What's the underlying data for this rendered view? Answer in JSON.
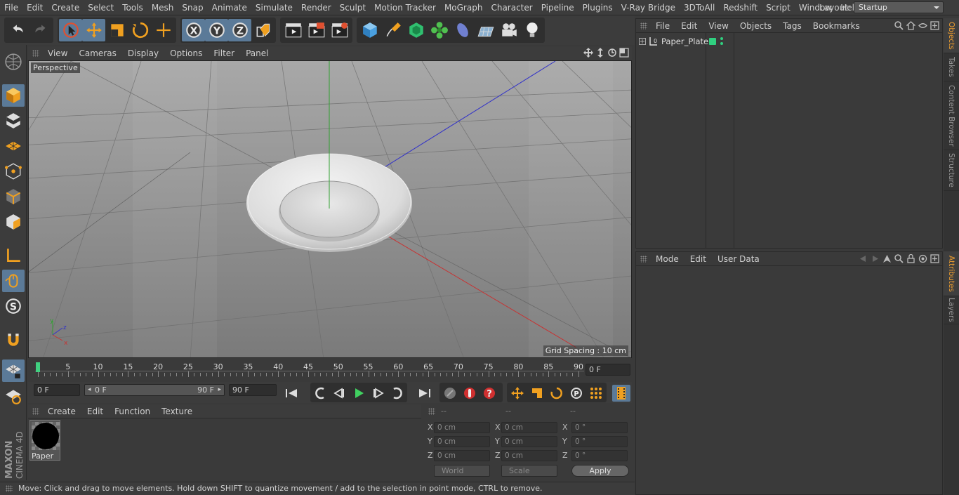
{
  "menubar": {
    "items": [
      "File",
      "Edit",
      "Create",
      "Select",
      "Tools",
      "Mesh",
      "Snap",
      "Animate",
      "Simulate",
      "Render",
      "Sculpt",
      "Motion Tracker",
      "MoGraph",
      "Character",
      "Pipeline",
      "Plugins",
      "V-Ray Bridge",
      "3DToAll",
      "Redshift",
      "Script",
      "Window",
      "Help"
    ],
    "layout_label": "Layout:",
    "layout_value": "Startup"
  },
  "toolbar": {
    "icons": [
      "undo-icon",
      "redo-icon",
      "live-selection-icon",
      "move-icon",
      "scale-icon",
      "rotate-icon",
      "last-tool-icon",
      "x-axis-icon",
      "y-axis-icon",
      "z-axis-icon",
      "coordinate-system-icon",
      "render-view-icon",
      "render-picture-viewer-icon",
      "edit-render-settings-icon",
      "cube-icon",
      "pen-icon",
      "subdivision-icon",
      "mograph-cloner-icon",
      "deformer-icon",
      "floor-icon",
      "camera-icon",
      "light-icon"
    ]
  },
  "viewport": {
    "menu": [
      "View",
      "Cameras",
      "Display",
      "Options",
      "Filter",
      "Panel"
    ],
    "label": "Perspective",
    "grid_spacing": "Grid Spacing : 10 cm"
  },
  "timeline": {
    "ticks": [
      "0",
      "5",
      "10",
      "15",
      "20",
      "25",
      "30",
      "35",
      "40",
      "45",
      "50",
      "55",
      "60",
      "65",
      "70",
      "75",
      "80",
      "85",
      "90"
    ],
    "current_frame": "0 F"
  },
  "playbar": {
    "start_field": "0 F",
    "range_start": "0 F",
    "range_end": "90 F",
    "end_field": "90 F"
  },
  "material_manager": {
    "menu": [
      "Create",
      "Edit",
      "Function",
      "Texture"
    ],
    "materials": [
      {
        "name": "Paper"
      }
    ]
  },
  "coordinates": {
    "headers": [
      "--",
      "--",
      "--"
    ],
    "rows": [
      {
        "axis": "X",
        "pos": "0 cm",
        "size": "0 cm",
        "rot": "0 °"
      },
      {
        "axis": "Y",
        "pos": "0 cm",
        "size": "0 cm",
        "rot": "0 °"
      },
      {
        "axis": "Z",
        "pos": "0 cm",
        "size": "0 cm",
        "rot": "0 °"
      }
    ],
    "mode_select": "World",
    "scale_select": "Scale",
    "apply_label": "Apply"
  },
  "object_manager": {
    "menu": [
      "File",
      "Edit",
      "View",
      "Objects",
      "Tags",
      "Bookmarks"
    ],
    "objects": [
      {
        "name": "Paper_Plate"
      }
    ]
  },
  "attribute_manager": {
    "menu": [
      "Mode",
      "Edit",
      "User Data"
    ]
  },
  "right_tabs": [
    "Objects",
    "Takes",
    "Content Browser",
    "Structure",
    "Attributes",
    "Layers"
  ],
  "status": "Move: Click and drag to move elements. Hold down SHIFT to quantize movement / add to the selection in point mode, CTRL to remove.",
  "brand": {
    "line1": "MAXON",
    "line2": "CINEMA 4D"
  },
  "colors": {
    "accent": "#5b7a98",
    "x_axis": "#c83232",
    "y_axis": "#32a032",
    "z_axis": "#3232c8",
    "active_tab": "#f0a030"
  }
}
